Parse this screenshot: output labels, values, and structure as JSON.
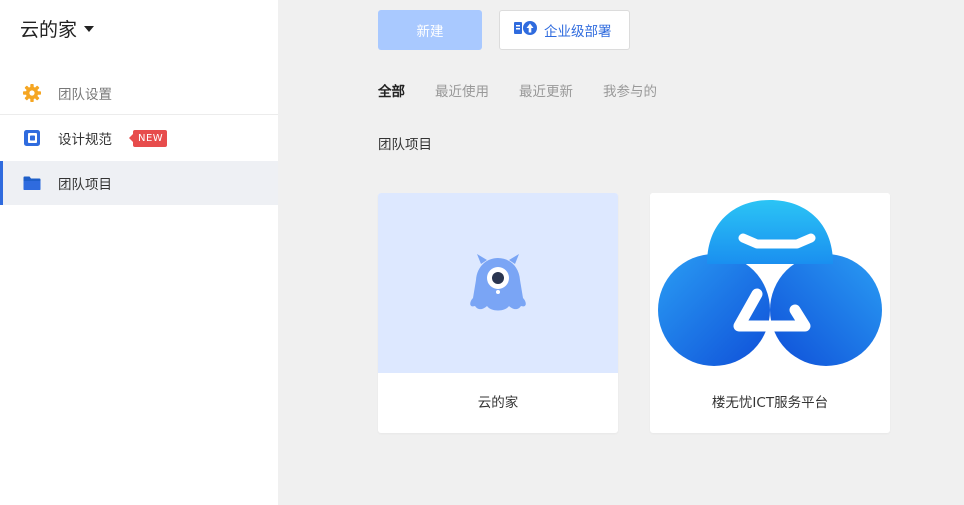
{
  "team": {
    "name": "云的家"
  },
  "sidebar": {
    "items": [
      {
        "label": "团队设置",
        "icon": "gear-icon"
      },
      {
        "label": "设计规范",
        "icon": "design-spec-icon",
        "badge": "NEW"
      },
      {
        "label": "团队项目",
        "icon": "folder-icon",
        "active": true
      }
    ]
  },
  "toolbar": {
    "new_label": "新建",
    "enterprise_label": "企业级部署"
  },
  "tabs": [
    {
      "label": "全部",
      "active": true
    },
    {
      "label": "最近使用"
    },
    {
      "label": "最近更新"
    },
    {
      "label": "我参与的"
    }
  ],
  "section": {
    "title": "团队项目"
  },
  "projects": [
    {
      "name": "云的家",
      "thumb": "default-mascot-icon"
    },
    {
      "name": "楼无忧ICT服务平台",
      "thumb": "cloud-logo-icon"
    }
  ],
  "colors": {
    "accent": "#2f6bde",
    "new_button": "#a9c9ff",
    "badge": "#e74c4c",
    "gear": "#f5a623",
    "thumb_bg": "#dde8ff",
    "mascot": "#7aa5f5"
  }
}
